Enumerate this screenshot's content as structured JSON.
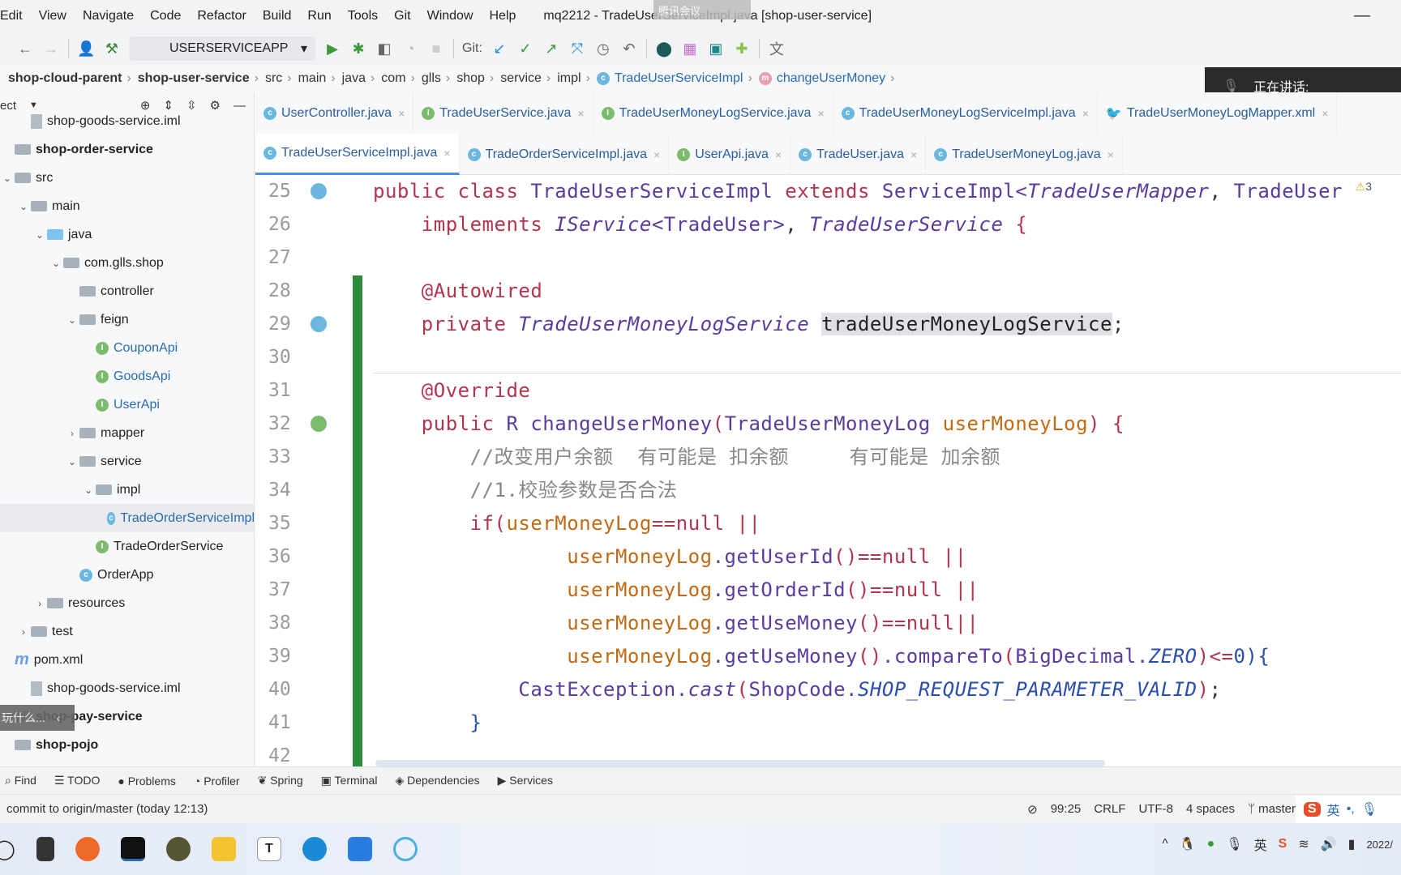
{
  "menu": {
    "items": [
      "Edit",
      "View",
      "Navigate",
      "Code",
      "Refactor",
      "Build",
      "Run",
      "Tools",
      "Git",
      "Window",
      "Help"
    ],
    "window_title": "mq2212 - TradeUserServiceImpl.java [shop-user-service]",
    "meeting_overlay": "腾讯会议"
  },
  "toolbar": {
    "run_config": "USERSERVICEAPP",
    "git_label": "Git:"
  },
  "breadcrumb": [
    "shop-cloud-parent",
    "shop-user-service",
    "src",
    "main",
    "java",
    "com",
    "glls",
    "shop",
    "service",
    "impl",
    "TradeUserServiceImpl",
    "changeUserMoney"
  ],
  "speaking_overlay": "正在讲话:",
  "sidebar": {
    "header": "ect",
    "items": [
      {
        "label": "shop-goods-service.iml",
        "icon": "iml-file-icon",
        "level": 1
      },
      {
        "label": "shop-order-service",
        "icon": "module-icon",
        "level": 0,
        "bold": true
      },
      {
        "label": "src",
        "icon": "folder-icon",
        "level": 0,
        "expanded": true
      },
      {
        "label": "main",
        "icon": "folder-icon",
        "level": 1,
        "expanded": true
      },
      {
        "label": "java",
        "icon": "source-folder-icon",
        "level": 2,
        "expanded": true
      },
      {
        "label": "com.glls.shop",
        "icon": "package-icon",
        "level": 3,
        "expanded": true
      },
      {
        "label": "controller",
        "icon": "package-icon",
        "level": 4
      },
      {
        "label": "feign",
        "icon": "package-icon",
        "level": 4,
        "expanded": true
      },
      {
        "label": "CouponApi",
        "icon": "interface-icon",
        "level": 5,
        "link": true
      },
      {
        "label": "GoodsApi",
        "icon": "interface-icon",
        "level": 5,
        "link": true
      },
      {
        "label": "UserApi",
        "icon": "interface-icon",
        "level": 5,
        "link": true
      },
      {
        "label": "mapper",
        "icon": "package-icon",
        "level": 4,
        "expanded": false
      },
      {
        "label": "service",
        "icon": "package-icon",
        "level": 4,
        "expanded": true
      },
      {
        "label": "impl",
        "icon": "package-icon",
        "level": 5,
        "expanded": true
      },
      {
        "label": "TradeOrderServiceImpl",
        "icon": "class-icon",
        "level": 6,
        "link": true,
        "selected": true
      },
      {
        "label": "TradeOrderService",
        "icon": "interface-icon",
        "level": 5
      },
      {
        "label": "OrderApp",
        "icon": "spring-app-icon",
        "level": 4
      },
      {
        "label": "resources",
        "icon": "resources-folder-icon",
        "level": 2,
        "expanded": false
      },
      {
        "label": "test",
        "icon": "folder-icon",
        "level": 1,
        "expanded": false
      },
      {
        "label": "pom.xml",
        "icon": "maven-icon",
        "level": 0
      },
      {
        "label": "shop-goods-service.iml",
        "icon": "iml-file-icon",
        "level": 1
      },
      {
        "label": "shop-pay-service",
        "icon": "module-icon",
        "level": 0,
        "bold": true
      },
      {
        "label": "shop-pojo",
        "icon": "module-icon",
        "level": 0,
        "bold": true
      }
    ]
  },
  "toast": "玩什么...",
  "tabs": {
    "row1": [
      {
        "label": "UserController.java",
        "type": "C"
      },
      {
        "label": "TradeUserService.java",
        "type": "I"
      },
      {
        "label": "TradeUserMoneyLogService.java",
        "type": "I"
      },
      {
        "label": "TradeUserMoneyLogServiceImpl.java",
        "type": "C"
      },
      {
        "label": "TradeUserMoneyLogMapper.xml",
        "type": "X"
      }
    ],
    "row2": [
      {
        "label": "TradeUserServiceImpl.java",
        "type": "C",
        "active": true
      },
      {
        "label": "TradeOrderServiceImpl.java",
        "type": "C"
      },
      {
        "label": "UserApi.java",
        "type": "I"
      },
      {
        "label": "TradeUser.java",
        "type": "C"
      },
      {
        "label": "TradeUserMoneyLog.java",
        "type": "C"
      }
    ]
  },
  "editor": {
    "warnings": "3",
    "lines": [
      {
        "n": "25",
        "t": [
          [
            "public class ",
            "kw"
          ],
          [
            "TradeUserServiceImpl ",
            "ty"
          ],
          [
            "extends ",
            "kw"
          ],
          [
            "ServiceImpl<",
            "ty"
          ],
          [
            "TradeUserMapper",
            "it"
          ],
          [
            ", ",
            "pl"
          ],
          [
            "TradeUser",
            "ty"
          ]
        ]
      },
      {
        "n": "26",
        "t": [
          [
            "    implements ",
            "kw"
          ],
          [
            "IService",
            "it"
          ],
          [
            "<TradeUser>",
            "ty"
          ],
          [
            ", ",
            "pl"
          ],
          [
            "TradeUserService ",
            "it"
          ],
          [
            "{",
            "br"
          ]
        ]
      },
      {
        "n": "27",
        "t": []
      },
      {
        "n": "28",
        "t": [
          [
            "    @Autowired",
            "an"
          ]
        ]
      },
      {
        "n": "29",
        "t": [
          [
            "    private ",
            "kw"
          ],
          [
            "TradeUserMoneyLogService ",
            "it"
          ],
          [
            "tradeUserMoneyLogService",
            "hl"
          ],
          [
            ";",
            "pl"
          ]
        ]
      },
      {
        "n": "30",
        "t": []
      },
      {
        "n": "31",
        "t": [
          [
            "    @Override",
            "an"
          ]
        ]
      },
      {
        "n": "32",
        "t": [
          [
            "    public ",
            "kw"
          ],
          [
            "R ",
            "ty"
          ],
          [
            "changeUserMoney",
            "ty"
          ],
          [
            "(",
            "br"
          ],
          [
            "TradeUserMoneyLog ",
            "ty"
          ],
          [
            "userMoneyLog",
            "pa"
          ],
          [
            ") {",
            "br"
          ]
        ]
      },
      {
        "n": "33",
        "t": [
          [
            "        //改变用户余额  有可能是 扣余额     有可能是 加余额",
            "cm"
          ]
        ]
      },
      {
        "n": "34",
        "t": [
          [
            "        //1.校验参数是否合法",
            "cm"
          ]
        ]
      },
      {
        "n": "35",
        "t": [
          [
            "        if(",
            "kw"
          ],
          [
            "userMoneyLog",
            "pa"
          ],
          [
            "==null ||",
            "kw"
          ]
        ]
      },
      {
        "n": "36",
        "t": [
          [
            "                userMoneyLog",
            "pa"
          ],
          [
            ".getUserId",
            "ty"
          ],
          [
            "()",
            "br"
          ],
          [
            "==null ||",
            "kw"
          ]
        ]
      },
      {
        "n": "37",
        "t": [
          [
            "                userMoneyLog",
            "pa"
          ],
          [
            ".getOrderId",
            "ty"
          ],
          [
            "()",
            "br"
          ],
          [
            "==null ||",
            "kw"
          ]
        ]
      },
      {
        "n": "38",
        "t": [
          [
            "                userMoneyLog",
            "pa"
          ],
          [
            ".getUseMoney",
            "ty"
          ],
          [
            "()",
            "br"
          ],
          [
            "==null||",
            "kw"
          ]
        ]
      },
      {
        "n": "39",
        "t": [
          [
            "                userMoneyLog",
            "pa"
          ],
          [
            ".getUseMoney",
            "ty"
          ],
          [
            "()",
            "br"
          ],
          [
            ".compareTo",
            "ty"
          ],
          [
            "(",
            "br"
          ],
          [
            "BigDecimal.",
            "ty"
          ],
          [
            "ZERO",
            "st"
          ],
          [
            ")",
            "br"
          ],
          [
            "<=",
            "kw"
          ],
          [
            "0",
            "nu"
          ],
          [
            "){",
            "nu"
          ]
        ]
      },
      {
        "n": "40",
        "t": [
          [
            "            CastException.",
            "ty"
          ],
          [
            "cast",
            "it"
          ],
          [
            "(",
            "br"
          ],
          [
            "ShopCode.",
            "ty"
          ],
          [
            "SHOP_REQUEST_PARAMETER_VALID",
            "st"
          ],
          [
            ")",
            "br"
          ],
          [
            ";",
            "pl"
          ]
        ]
      },
      {
        "n": "41",
        "t": [
          [
            "        }",
            "nu"
          ]
        ]
      },
      {
        "n": "42",
        "t": []
      }
    ]
  },
  "tool_windows": [
    "Find",
    "TODO",
    "Problems",
    "Profiler",
    "Spring",
    "Terminal",
    "Dependencies",
    "Services"
  ],
  "status": {
    "message": "commit to origin/master (today 12:13)",
    "position": "99:25",
    "line_sep": "CRLF",
    "encoding": "UTF-8",
    "indent": "4 spaces",
    "branch": "master"
  },
  "ime": {
    "lang": "英",
    "punct": "•,"
  },
  "tray": {
    "lang": "英",
    "date": "2022/"
  },
  "colors": {
    "accent": "#4a90e2",
    "gutter_changed": "#2e8b3b",
    "keyword": "#b2354d",
    "type": "#5b3b9e",
    "param": "#c06a14"
  }
}
